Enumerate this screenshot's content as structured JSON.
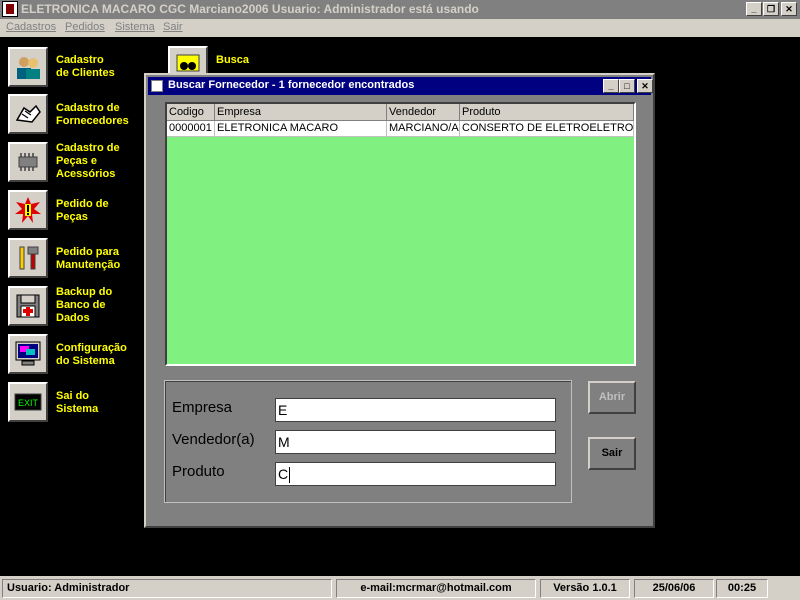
{
  "window": {
    "title": "ELETRONICA MACARO     CGC Marciano2006    Usuario: Administrador  está usando",
    "controls": [
      "_",
      "❐",
      "✕"
    ]
  },
  "menu": [
    {
      "label": "Cadastros"
    },
    {
      "label": "Pedidos"
    },
    {
      "label": "Sistema"
    },
    {
      "label": "Sair"
    }
  ],
  "sidebar": {
    "items": [
      {
        "label": "Cadastro\nde Clientes",
        "icon": "people-icon"
      },
      {
        "label": "Cadastro de\nFornecedores",
        "icon": "handshake-icon"
      },
      {
        "label": "Cadastro de\nPeças e\nAcessórios",
        "icon": "chip-icon"
      },
      {
        "label": "Pedido de\nPeças",
        "icon": "alert-icon"
      },
      {
        "label": "Pedido para\nManutenção",
        "icon": "tools-icon"
      },
      {
        "label": "Backup do\nBanco de\nDados",
        "icon": "floppy-icon"
      },
      {
        "label": "Configuração\ndo Sistema",
        "icon": "monitor-icon"
      },
      {
        "label": "Sai do\nSistema",
        "icon": "exit-icon"
      }
    ],
    "busca": {
      "label": "Busca",
      "icon": "binoculars-icon"
    },
    "exit_icon_text": "EXIT"
  },
  "dialog": {
    "title": "Buscar Fornecedor - 1 fornecedor encontrados",
    "grid": {
      "columns": [
        "Codigo",
        "Empresa",
        "Vendedor",
        "Produto"
      ],
      "rows": [
        [
          "0000001",
          "ELETRONICA MACARO",
          "MARCIANO/A",
          "CONSERTO DE ELETROELETRO"
        ]
      ]
    },
    "filters": {
      "empresa_label": "Empresa",
      "empresa_value": "E",
      "vendedor_label": "Vendedor(a)",
      "vendedor_value": "M",
      "produto_label": "Produto",
      "produto_value": "C"
    },
    "buttons": {
      "abrir": "Abrir",
      "sair": "Sair"
    }
  },
  "statusbar": {
    "user": "Usuario: Administrador",
    "email": "e-mail:mcrmar@hotmail.com",
    "version": "Versão 1.0.1",
    "date": "25/06/06",
    "time": "00:25"
  },
  "colors": {
    "sidebar_text": "#ffff00",
    "grid_background": "#80f080",
    "dialog_titlebar": "#000080",
    "desktop": "#000000"
  }
}
